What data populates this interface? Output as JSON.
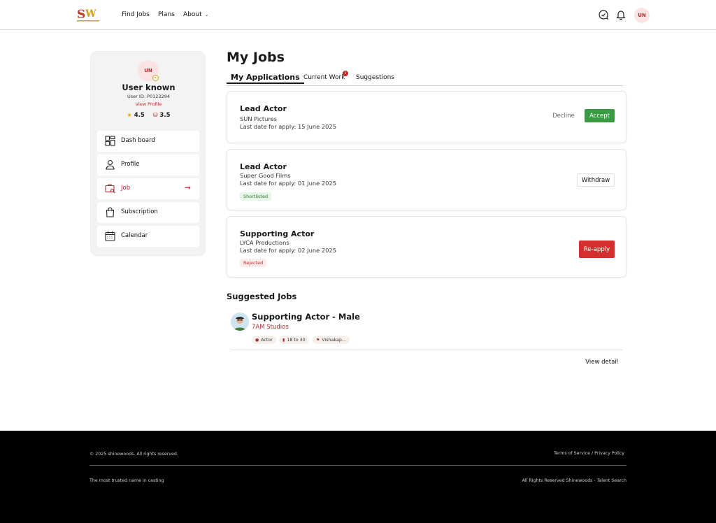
{
  "header": {
    "logo_text": "SW",
    "nav": [
      "Find Jobs",
      "Plans",
      "About"
    ],
    "user_initials": "UN"
  },
  "profile": {
    "initials": "UN",
    "name": "User known",
    "user_id": "User ID: P0123294",
    "view_profile": "View Profile",
    "rating": "4.5",
    "score": "3.5"
  },
  "menu": [
    {
      "label": "Dash board",
      "icon": "dashboard-icon"
    },
    {
      "label": "Profile",
      "icon": "user-icon"
    },
    {
      "label": "Job",
      "icon": "job-search-icon",
      "active": true
    },
    {
      "label": "Subscription",
      "icon": "shopping-bag-icon"
    },
    {
      "label": "Calendar",
      "icon": "calendar-icon"
    }
  ],
  "main": {
    "title": "My Jobs",
    "tabs": [
      "My Applications",
      "Current Work",
      "Suggestions"
    ],
    "current_work_count": "1"
  },
  "applications": [
    {
      "role": "Lead Actor",
      "company": "SUN Pictures",
      "last_date": "Last date for apply: 15 June 2025",
      "actions": [
        "Decline",
        "Accept"
      ]
    },
    {
      "role": "Lead Actor",
      "company": "Super Good Films",
      "last_date": "Last date for apply: 01 June 2025",
      "status": "Shortlisted",
      "actions": [
        "Withdraw"
      ]
    },
    {
      "role": "Supporting Actor",
      "company": "LYCA Productions",
      "last_date": "Last date for apply: 02 June 2025",
      "status": "Rejected",
      "actions": [
        "Re-apply"
      ]
    }
  ],
  "suggested": {
    "title": "Suggested Jobs",
    "job": {
      "role": "Supporting Actor - Male",
      "company": "7AM Studios",
      "chips": [
        "Actor",
        "18 to 30",
        "Vishakap..."
      ],
      "view_detail": "View detail"
    }
  },
  "footer": {
    "copyright": "© 2025 shinewoods. All rights reserved.",
    "links": "Terms of Service / Privacy Policy",
    "tagline": "The most trusted name in casting",
    "rights": "All Rights Reserved Shinewoods - Talent Search"
  },
  "colors": {
    "brand": "#b52b2b",
    "accept": "#3a9a43",
    "reapply": "#d32f2f",
    "footer_bg": "#000000"
  }
}
